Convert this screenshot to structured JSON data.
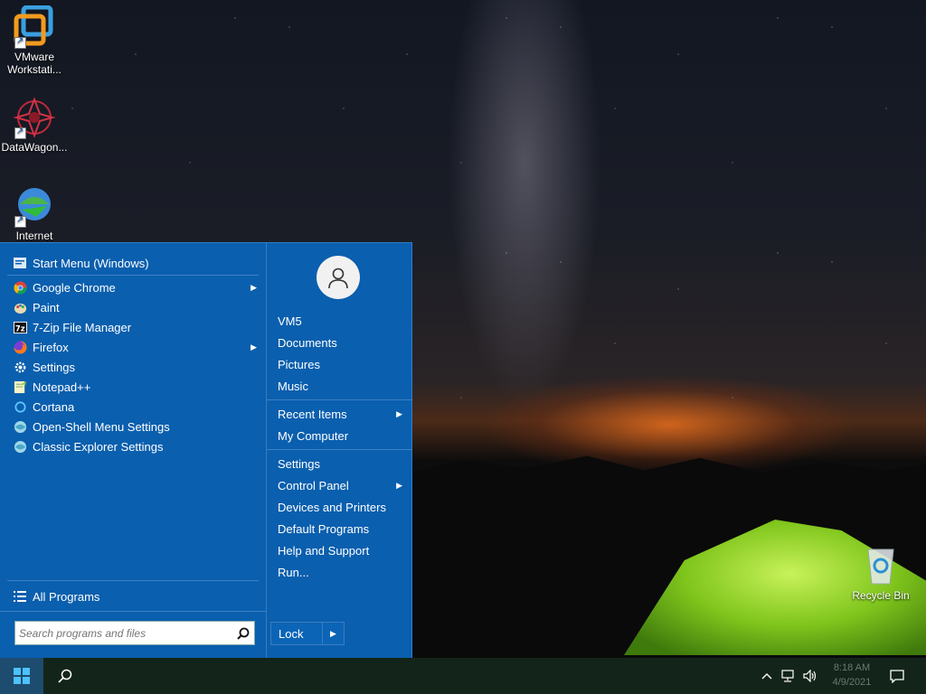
{
  "desktop": {
    "icons": [
      {
        "label": "VMware Workstati...",
        "icon": "vmware-icon"
      },
      {
        "label": "DataWagon...",
        "icon": "datawagon-icon"
      },
      {
        "label": "Internet",
        "icon": "internet-download-manager-icon"
      },
      {
        "label": "Recycle Bin",
        "icon": "recycle-bin-icon"
      }
    ]
  },
  "start_menu": {
    "pinned_header": "Start Menu (Windows)",
    "programs": [
      {
        "label": "Google Chrome",
        "icon": "chrome-icon",
        "submenu": true
      },
      {
        "label": "Paint",
        "icon": "paint-icon",
        "submenu": false
      },
      {
        "label": "7-Zip File Manager",
        "icon": "7zip-icon",
        "submenu": false
      },
      {
        "label": "Firefox",
        "icon": "firefox-icon",
        "submenu": true
      },
      {
        "label": "Settings",
        "icon": "gear-icon",
        "submenu": false
      },
      {
        "label": "Notepad++",
        "icon": "notepad-icon",
        "submenu": false
      },
      {
        "label": "Cortana",
        "icon": "cortana-icon",
        "submenu": false
      },
      {
        "label": "Open-Shell Menu Settings",
        "icon": "shell-icon",
        "submenu": false
      },
      {
        "label": "Classic Explorer Settings",
        "icon": "shell-icon",
        "submenu": false
      }
    ],
    "all_programs": "All Programs",
    "search_placeholder": "Search programs and files",
    "right": {
      "user": "VM5",
      "group1": [
        "Documents",
        "Pictures",
        "Music"
      ],
      "recent_items": "Recent Items",
      "my_computer": "My Computer",
      "settings": "Settings",
      "control_panel": "Control Panel",
      "group3": [
        "Devices and Printers",
        "Default Programs",
        "Help and Support",
        "Run..."
      ],
      "lock": "Lock"
    }
  },
  "taskbar": {
    "time": "8:18 AM",
    "date": "4/9/2021"
  },
  "colors": {
    "menu_bg": "#0a5fae",
    "taskbar_bg": "#13251a"
  }
}
